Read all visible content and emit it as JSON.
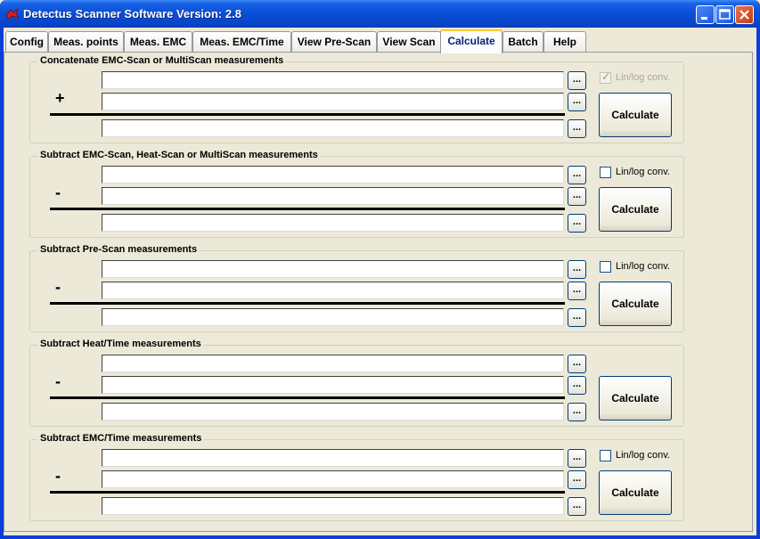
{
  "window": {
    "title": "Detectus Scanner Software Version: 2.8"
  },
  "tabs": [
    {
      "label": "Config"
    },
    {
      "label": "Meas. points"
    },
    {
      "label": "Meas. EMC"
    },
    {
      "label": "Meas. EMC/Time"
    },
    {
      "label": "View Pre-Scan"
    },
    {
      "label": "View Scan"
    },
    {
      "label": "Calculate",
      "active": true
    },
    {
      "label": "Batch"
    },
    {
      "label": "Help"
    }
  ],
  "browse_label": "...",
  "groups": [
    {
      "title": "Concatenate EMC-Scan or MultiScan measurements",
      "operator": "+",
      "checkbox_label": "Lin/log conv.",
      "checkbox_checked": true,
      "checkbox_enabled": false,
      "button_label": "Calculate",
      "fields": [
        "",
        "",
        ""
      ]
    },
    {
      "title": "Subtract EMC-Scan, Heat-Scan or MultiScan measurements",
      "operator": "-",
      "checkbox_label": "Lin/log conv.",
      "checkbox_checked": false,
      "checkbox_enabled": true,
      "button_label": "Calculate",
      "fields": [
        "",
        "",
        ""
      ]
    },
    {
      "title": "Subtract Pre-Scan measurements",
      "operator": "-",
      "checkbox_label": "Lin/log conv.",
      "checkbox_checked": false,
      "checkbox_enabled": true,
      "button_label": "Calculate",
      "fields": [
        "",
        "",
        ""
      ]
    },
    {
      "title": "Subtract Heat/Time measurements",
      "operator": "-",
      "button_label": "Calculate",
      "fields": [
        "",
        "",
        ""
      ]
    },
    {
      "title": "Subtract EMC/Time measurements",
      "operator": "-",
      "checkbox_label": "Lin/log conv.",
      "checkbox_checked": false,
      "checkbox_enabled": true,
      "button_label": "Calculate",
      "fields": [
        "",
        "",
        ""
      ]
    }
  ]
}
